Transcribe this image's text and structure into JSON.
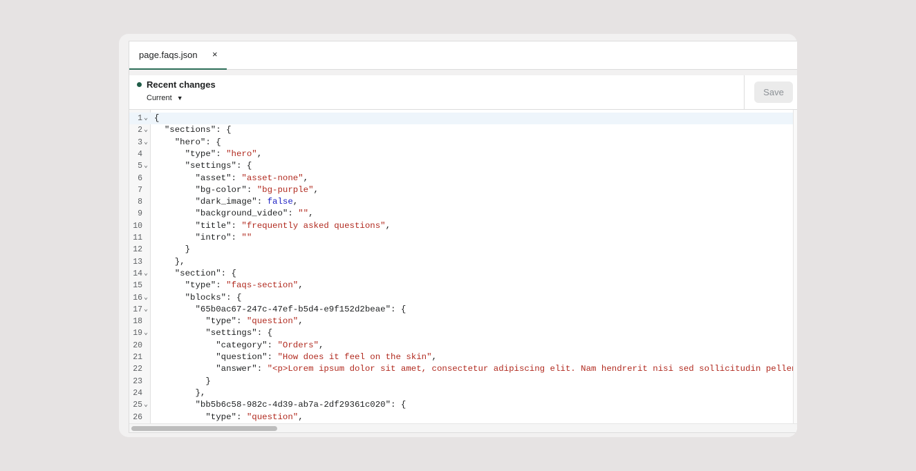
{
  "tabs": [
    {
      "label": "page.faqs.json",
      "close": "×"
    }
  ],
  "toolbar": {
    "recent_changes": "Recent changes",
    "version": "Current",
    "version_caret": "▼",
    "save_label": "Save"
  },
  "fold_icon": "⌄",
  "editor": {
    "lines": [
      {
        "n": "1",
        "fold": true,
        "parts": [
          [
            "p",
            "{"
          ]
        ]
      },
      {
        "n": "2",
        "fold": true,
        "parts": [
          [
            "p",
            "  \"sections\": {"
          ]
        ]
      },
      {
        "n": "3",
        "fold": true,
        "parts": [
          [
            "p",
            "    \"hero\": {"
          ]
        ]
      },
      {
        "n": "4",
        "fold": false,
        "parts": [
          [
            "p",
            "      \"type\": "
          ],
          [
            "s",
            "\"hero\""
          ],
          [
            "p",
            ","
          ]
        ]
      },
      {
        "n": "5",
        "fold": true,
        "parts": [
          [
            "p",
            "      \"settings\": {"
          ]
        ]
      },
      {
        "n": "6",
        "fold": false,
        "parts": [
          [
            "p",
            "        \"asset\": "
          ],
          [
            "s",
            "\"asset-none\""
          ],
          [
            "p",
            ","
          ]
        ]
      },
      {
        "n": "7",
        "fold": false,
        "parts": [
          [
            "p",
            "        \"bg-color\": "
          ],
          [
            "s",
            "\"bg-purple\""
          ],
          [
            "p",
            ","
          ]
        ]
      },
      {
        "n": "8",
        "fold": false,
        "parts": [
          [
            "p",
            "        \"dark_image\": "
          ],
          [
            "b",
            "false"
          ],
          [
            "p",
            ","
          ]
        ]
      },
      {
        "n": "9",
        "fold": false,
        "parts": [
          [
            "p",
            "        \"background_video\": "
          ],
          [
            "s",
            "\"\""
          ],
          [
            "p",
            ","
          ]
        ]
      },
      {
        "n": "10",
        "fold": false,
        "parts": [
          [
            "p",
            "        \"title\": "
          ],
          [
            "s",
            "\"frequently asked questions\""
          ],
          [
            "p",
            ","
          ]
        ]
      },
      {
        "n": "11",
        "fold": false,
        "parts": [
          [
            "p",
            "        \"intro\": "
          ],
          [
            "s",
            "\"\""
          ]
        ]
      },
      {
        "n": "12",
        "fold": false,
        "parts": [
          [
            "p",
            "      }"
          ]
        ]
      },
      {
        "n": "13",
        "fold": false,
        "parts": [
          [
            "p",
            "    },"
          ]
        ]
      },
      {
        "n": "14",
        "fold": true,
        "parts": [
          [
            "p",
            "    \"section\": {"
          ]
        ]
      },
      {
        "n": "15",
        "fold": false,
        "parts": [
          [
            "p",
            "      \"type\": "
          ],
          [
            "s",
            "\"faqs-section\""
          ],
          [
            "p",
            ","
          ]
        ]
      },
      {
        "n": "16",
        "fold": true,
        "parts": [
          [
            "p",
            "      \"blocks\": {"
          ]
        ]
      },
      {
        "n": "17",
        "fold": true,
        "parts": [
          [
            "p",
            "        \"65b0ac67-247c-47ef-b5d4-e9f152d2beae\": {"
          ]
        ]
      },
      {
        "n": "18",
        "fold": false,
        "parts": [
          [
            "p",
            "          \"type\": "
          ],
          [
            "s",
            "\"question\""
          ],
          [
            "p",
            ","
          ]
        ]
      },
      {
        "n": "19",
        "fold": true,
        "parts": [
          [
            "p",
            "          \"settings\": {"
          ]
        ]
      },
      {
        "n": "20",
        "fold": false,
        "parts": [
          [
            "p",
            "            \"category\": "
          ],
          [
            "s",
            "\"Orders\""
          ],
          [
            "p",
            ","
          ]
        ]
      },
      {
        "n": "21",
        "fold": false,
        "parts": [
          [
            "p",
            "            \"question\": "
          ],
          [
            "s",
            "\"How does it feel on the skin\""
          ],
          [
            "p",
            ","
          ]
        ]
      },
      {
        "n": "22",
        "fold": false,
        "parts": [
          [
            "p",
            "            \"answer\": "
          ],
          [
            "s",
            "\"<p>Lorem ipsum dolor sit amet, consectetur adipiscing elit. Nam hendrerit nisi sed sollicitudin pellen"
          ]
        ]
      },
      {
        "n": "23",
        "fold": false,
        "parts": [
          [
            "p",
            "          }"
          ]
        ]
      },
      {
        "n": "24",
        "fold": false,
        "parts": [
          [
            "p",
            "        },"
          ]
        ]
      },
      {
        "n": "25",
        "fold": true,
        "parts": [
          [
            "p",
            "        \"bb5b6c58-982c-4d39-ab7a-2df29361c020\": {"
          ]
        ]
      },
      {
        "n": "26",
        "fold": false,
        "parts": [
          [
            "p",
            "          \"type\": "
          ],
          [
            "s",
            "\"question\""
          ],
          [
            "p",
            ","
          ]
        ]
      }
    ]
  }
}
